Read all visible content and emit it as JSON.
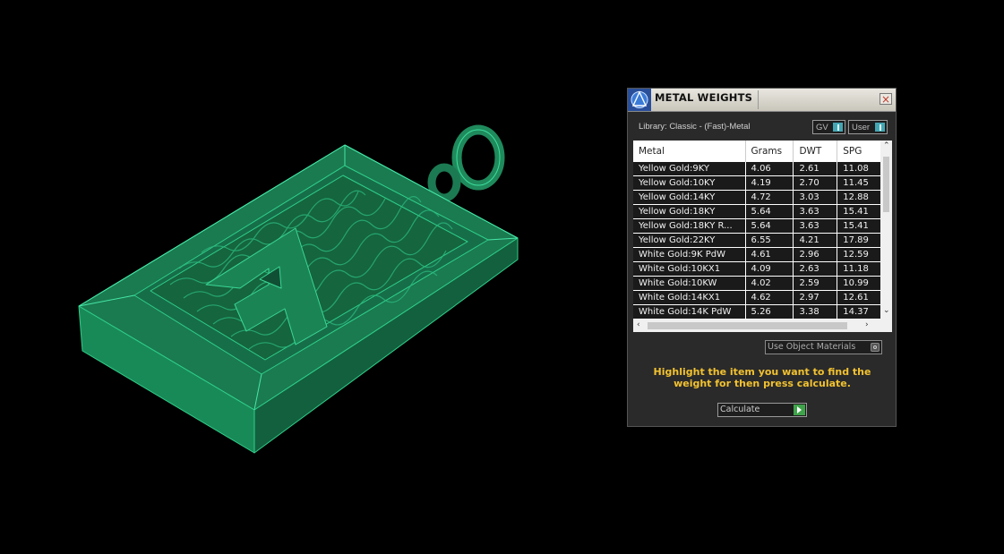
{
  "panel": {
    "title": "METAL WEIGHTS",
    "close_label": "×",
    "library_label": "Library: Classic - (Fast)-Metal",
    "unit_select": "GV",
    "source_select": "User",
    "use_object_materials_label": "Use Object Materials",
    "hint": "Highlight the item you want to find the weight for then press calculate.",
    "calculate_label": "Calculate"
  },
  "table": {
    "columns": [
      "Metal",
      "Grams",
      "DWT",
      "SPG"
    ],
    "rows": [
      [
        "Yellow Gold:9KY",
        "4.06",
        "2.61",
        "11.08"
      ],
      [
        "Yellow Gold:10KY",
        "4.19",
        "2.70",
        "11.45"
      ],
      [
        "Yellow Gold:14KY",
        "4.72",
        "3.03",
        "12.88"
      ],
      [
        "Yellow Gold:18KY",
        "5.64",
        "3.63",
        "15.41"
      ],
      [
        "Yellow Gold:18KY R...",
        "5.64",
        "3.63",
        "15.41"
      ],
      [
        "Yellow Gold:22KY",
        "6.55",
        "4.21",
        "17.89"
      ],
      [
        "White Gold:9K PdW",
        "4.61",
        "2.96",
        "12.59"
      ],
      [
        "White Gold:10KX1",
        "4.09",
        "2.63",
        "11.18"
      ],
      [
        "White Gold:10KW",
        "4.02",
        "2.59",
        "10.99"
      ],
      [
        "White Gold:14KX1",
        "4.62",
        "2.97",
        "12.61"
      ],
      [
        "White Gold:14K PdW",
        "5.26",
        "3.38",
        "14.37"
      ]
    ]
  },
  "colors": {
    "model_green": "#1f8a5c",
    "hint_yellow": "#f2c230",
    "accent_teal": "#44a6b3",
    "calc_green": "#3fa34a"
  }
}
